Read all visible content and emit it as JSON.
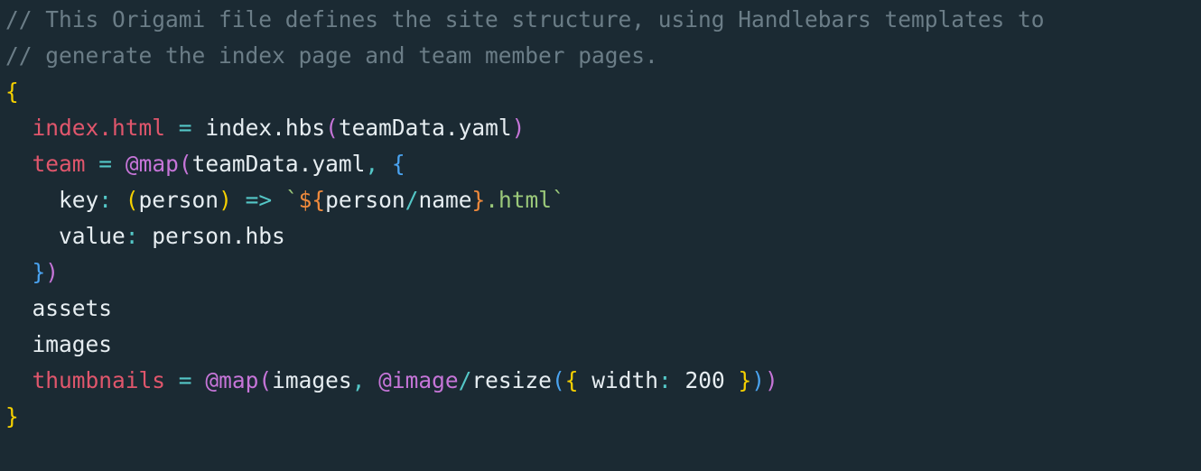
{
  "editor": {
    "background": "#1b2a33",
    "lines": [
      [
        {
          "text": "// This Origami file defines the site structure, using Handlebars templates to",
          "color": "#6b7d87"
        }
      ],
      [
        {
          "text": "// generate the index page and team member pages.",
          "color": "#6b7d87"
        }
      ],
      [
        {
          "text": "{",
          "color": "#f5d000"
        }
      ],
      [
        {
          "text": "  ",
          "color": "#e6edf1"
        },
        {
          "text": "index.html",
          "color": "#e0566c"
        },
        {
          "text": " ",
          "color": "#e6edf1"
        },
        {
          "text": "=",
          "color": "#54c7c7"
        },
        {
          "text": " index.hbs",
          "color": "#e6edf1"
        },
        {
          "text": "(",
          "color": "#c675d8"
        },
        {
          "text": "teamData.yaml",
          "color": "#e6edf1"
        },
        {
          "text": ")",
          "color": "#c675d8"
        }
      ],
      [
        {
          "text": "  ",
          "color": "#e6edf1"
        },
        {
          "text": "team",
          "color": "#e0566c"
        },
        {
          "text": " ",
          "color": "#e6edf1"
        },
        {
          "text": "=",
          "color": "#54c7c7"
        },
        {
          "text": " ",
          "color": "#e6edf1"
        },
        {
          "text": "@map",
          "color": "#c675d8"
        },
        {
          "text": "(",
          "color": "#c675d8"
        },
        {
          "text": "teamData.yaml",
          "color": "#e6edf1"
        },
        {
          "text": ", ",
          "color": "#54c7c7"
        },
        {
          "text": "{",
          "color": "#4aa3f0"
        }
      ],
      [
        {
          "text": "    key",
          "color": "#e6edf1"
        },
        {
          "text": ": ",
          "color": "#54c7c7"
        },
        {
          "text": "(",
          "color": "#f5d000"
        },
        {
          "text": "person",
          "color": "#e6edf1"
        },
        {
          "text": ")",
          "color": "#f5d000"
        },
        {
          "text": " ",
          "color": "#e6edf1"
        },
        {
          "text": "=>",
          "color": "#54c7c7"
        },
        {
          "text": " ",
          "color": "#e6edf1"
        },
        {
          "text": "`",
          "color": "#9bc97a"
        },
        {
          "text": "${",
          "color": "#f08a3c"
        },
        {
          "text": "person",
          "color": "#e6edf1"
        },
        {
          "text": "/",
          "color": "#54c7c7"
        },
        {
          "text": "name",
          "color": "#e6edf1"
        },
        {
          "text": "}",
          "color": "#f08a3c"
        },
        {
          "text": ".html`",
          "color": "#9bc97a"
        }
      ],
      [
        {
          "text": "    value",
          "color": "#e6edf1"
        },
        {
          "text": ": ",
          "color": "#54c7c7"
        },
        {
          "text": "person.hbs",
          "color": "#e6edf1"
        }
      ],
      [
        {
          "text": "  ",
          "color": "#e6edf1"
        },
        {
          "text": "}",
          "color": "#4aa3f0"
        },
        {
          "text": ")",
          "color": "#c675d8"
        }
      ],
      [
        {
          "text": "  assets",
          "color": "#e6edf1"
        }
      ],
      [
        {
          "text": "  images",
          "color": "#e6edf1"
        }
      ],
      [
        {
          "text": "  ",
          "color": "#e6edf1"
        },
        {
          "text": "thumbnails",
          "color": "#e0566c"
        },
        {
          "text": " ",
          "color": "#e6edf1"
        },
        {
          "text": "=",
          "color": "#54c7c7"
        },
        {
          "text": " ",
          "color": "#e6edf1"
        },
        {
          "text": "@map",
          "color": "#c675d8"
        },
        {
          "text": "(",
          "color": "#c675d8"
        },
        {
          "text": "images",
          "color": "#e6edf1"
        },
        {
          "text": ", ",
          "color": "#54c7c7"
        },
        {
          "text": "@image",
          "color": "#c675d8"
        },
        {
          "text": "/",
          "color": "#54c7c7"
        },
        {
          "text": "resize",
          "color": "#e6edf1"
        },
        {
          "text": "(",
          "color": "#4aa3f0"
        },
        {
          "text": "{",
          "color": "#f5d000"
        },
        {
          "text": " width",
          "color": "#e6edf1"
        },
        {
          "text": ": ",
          "color": "#54c7c7"
        },
        {
          "text": "200 ",
          "color": "#e6edf1"
        },
        {
          "text": "}",
          "color": "#f5d000"
        },
        {
          "text": ")",
          "color": "#4aa3f0"
        },
        {
          "text": ")",
          "color": "#c675d8"
        }
      ],
      [
        {
          "text": "}",
          "color": "#f5d000"
        }
      ]
    ]
  }
}
